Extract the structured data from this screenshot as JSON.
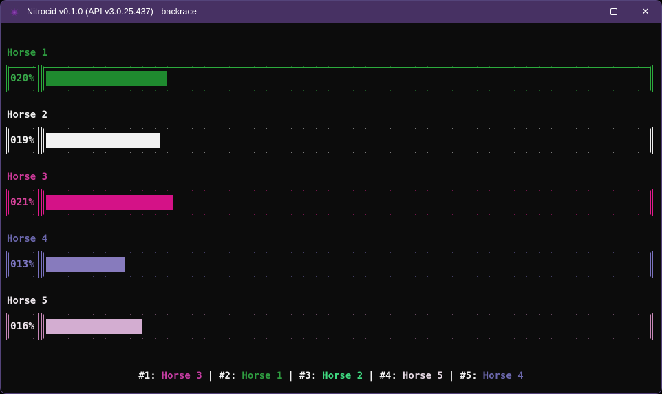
{
  "window": {
    "title": "Nitrocid v0.1.0 (API v3.0.25.437) - backrace",
    "titlebar_color": "#473163",
    "frame_color": "#54447a",
    "terminal_background": "#0c0c0c",
    "controls": {
      "minimize": "minimize",
      "maximize": "maximize",
      "close": "close"
    }
  },
  "horses": [
    {
      "name": "Horse 1",
      "percent": 20,
      "percent_label": "020%",
      "fill_width": "20%",
      "label_color": "#2f9e41",
      "border_color": "#2cab3d",
      "text_color": "#38a94a",
      "fill_color": "#1f8a2f"
    },
    {
      "name": "Horse 2",
      "percent": 19,
      "percent_label": "019%",
      "fill_width": "19%",
      "label_color": "#f2f2f2",
      "border_color": "#ececec",
      "text_color": "#f2f2f2",
      "fill_color": "#f2f2f2"
    },
    {
      "name": "Horse 3",
      "percent": 21,
      "percent_label": "021%",
      "fill_width": "21%",
      "label_color": "#ce3a9a",
      "border_color": "#e01b8c",
      "text_color": "#d8439c",
      "fill_color": "#d41287"
    },
    {
      "name": "Horse 4",
      "percent": 13,
      "percent_label": "013%",
      "fill_width": "13%",
      "label_color": "#6c68ae",
      "border_color": "#7a72bf",
      "text_color": "#7d77c2",
      "fill_color": "#877bbd"
    },
    {
      "name": "Horse 5",
      "percent": 16,
      "percent_label": "016%",
      "fill_width": "16%",
      "label_color": "#f0eaef",
      "border_color": "#c787b7",
      "text_color": "#f0e6ee",
      "fill_color": "#d3add1"
    }
  ],
  "ranking": {
    "separator": "|",
    "entries": [
      {
        "rank": "#1:",
        "name": "Horse 3",
        "color": "#c73da3"
      },
      {
        "rank": "#2:",
        "name": "Horse 1",
        "color": "#2f9e41"
      },
      {
        "rank": "#3:",
        "name": "Horse 2",
        "color": "#3fd980"
      },
      {
        "rank": "#4:",
        "name": "Horse 5",
        "color": "#e6d9e4"
      },
      {
        "rank": "#5:",
        "name": "Horse 4",
        "color": "#6c68ae"
      }
    ]
  }
}
